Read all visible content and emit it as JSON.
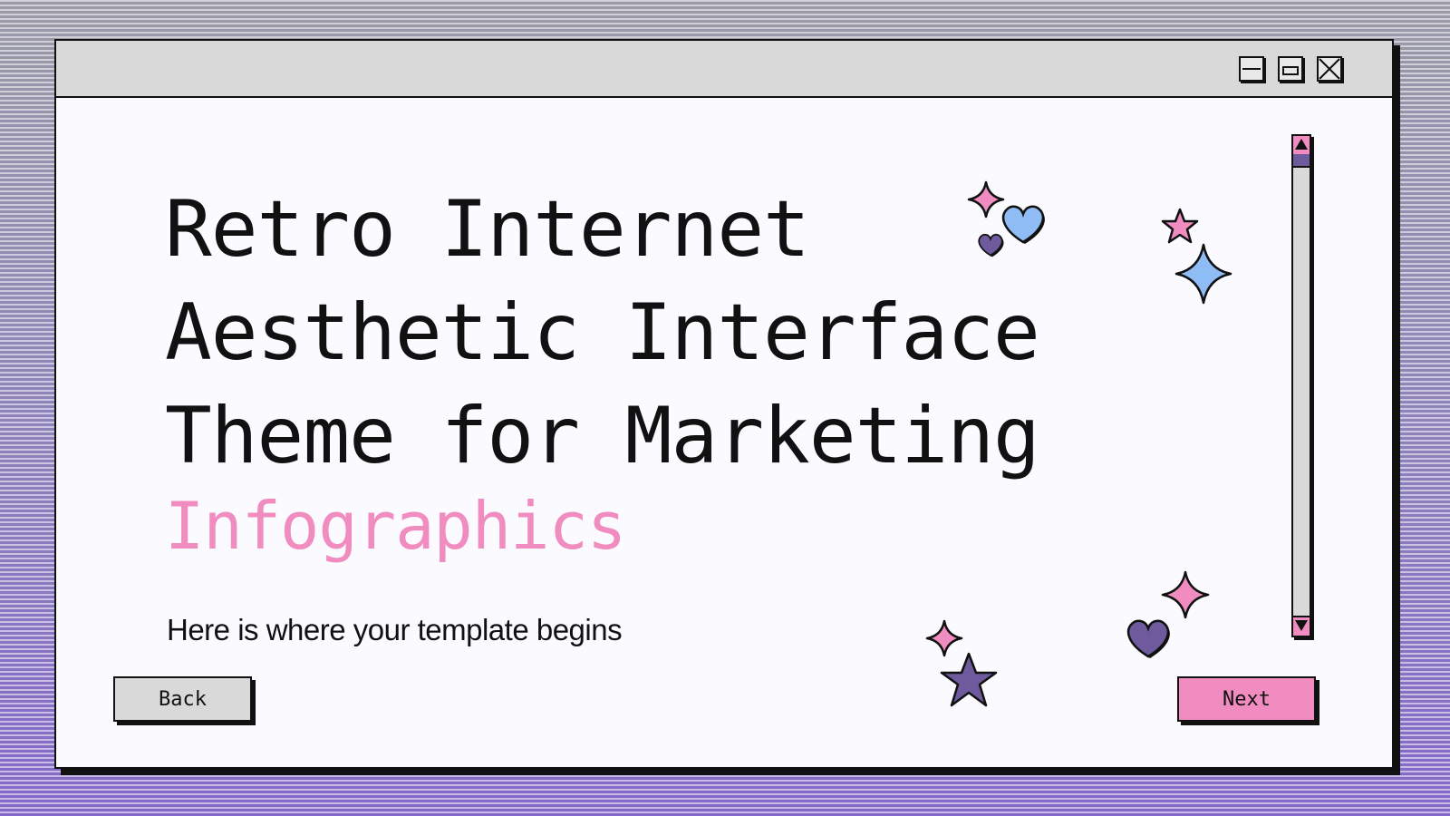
{
  "window": {
    "controls": [
      {
        "name": "minimize-button",
        "icon": "minimize-icon"
      },
      {
        "name": "maximize-button",
        "icon": "maximize-icon"
      },
      {
        "name": "close-button",
        "icon": "close-icon"
      }
    ]
  },
  "slide": {
    "title_lines": [
      "Retro Internet",
      "Aesthetic Interface",
      "Theme for Marketing"
    ],
    "title_accent": "Infographics",
    "subtitle": "Here is where your template begins"
  },
  "navigation": {
    "back_label": "Back",
    "next_label": "Next"
  },
  "colors": {
    "accent_pink": "#f08cc0",
    "accent_blue": "#8fbcf5",
    "accent_purple": "#6e5a9c",
    "chrome_gray": "#d9d9d9"
  },
  "decorations": [
    "sparkle-icon",
    "heart-icon",
    "star-icon"
  ]
}
